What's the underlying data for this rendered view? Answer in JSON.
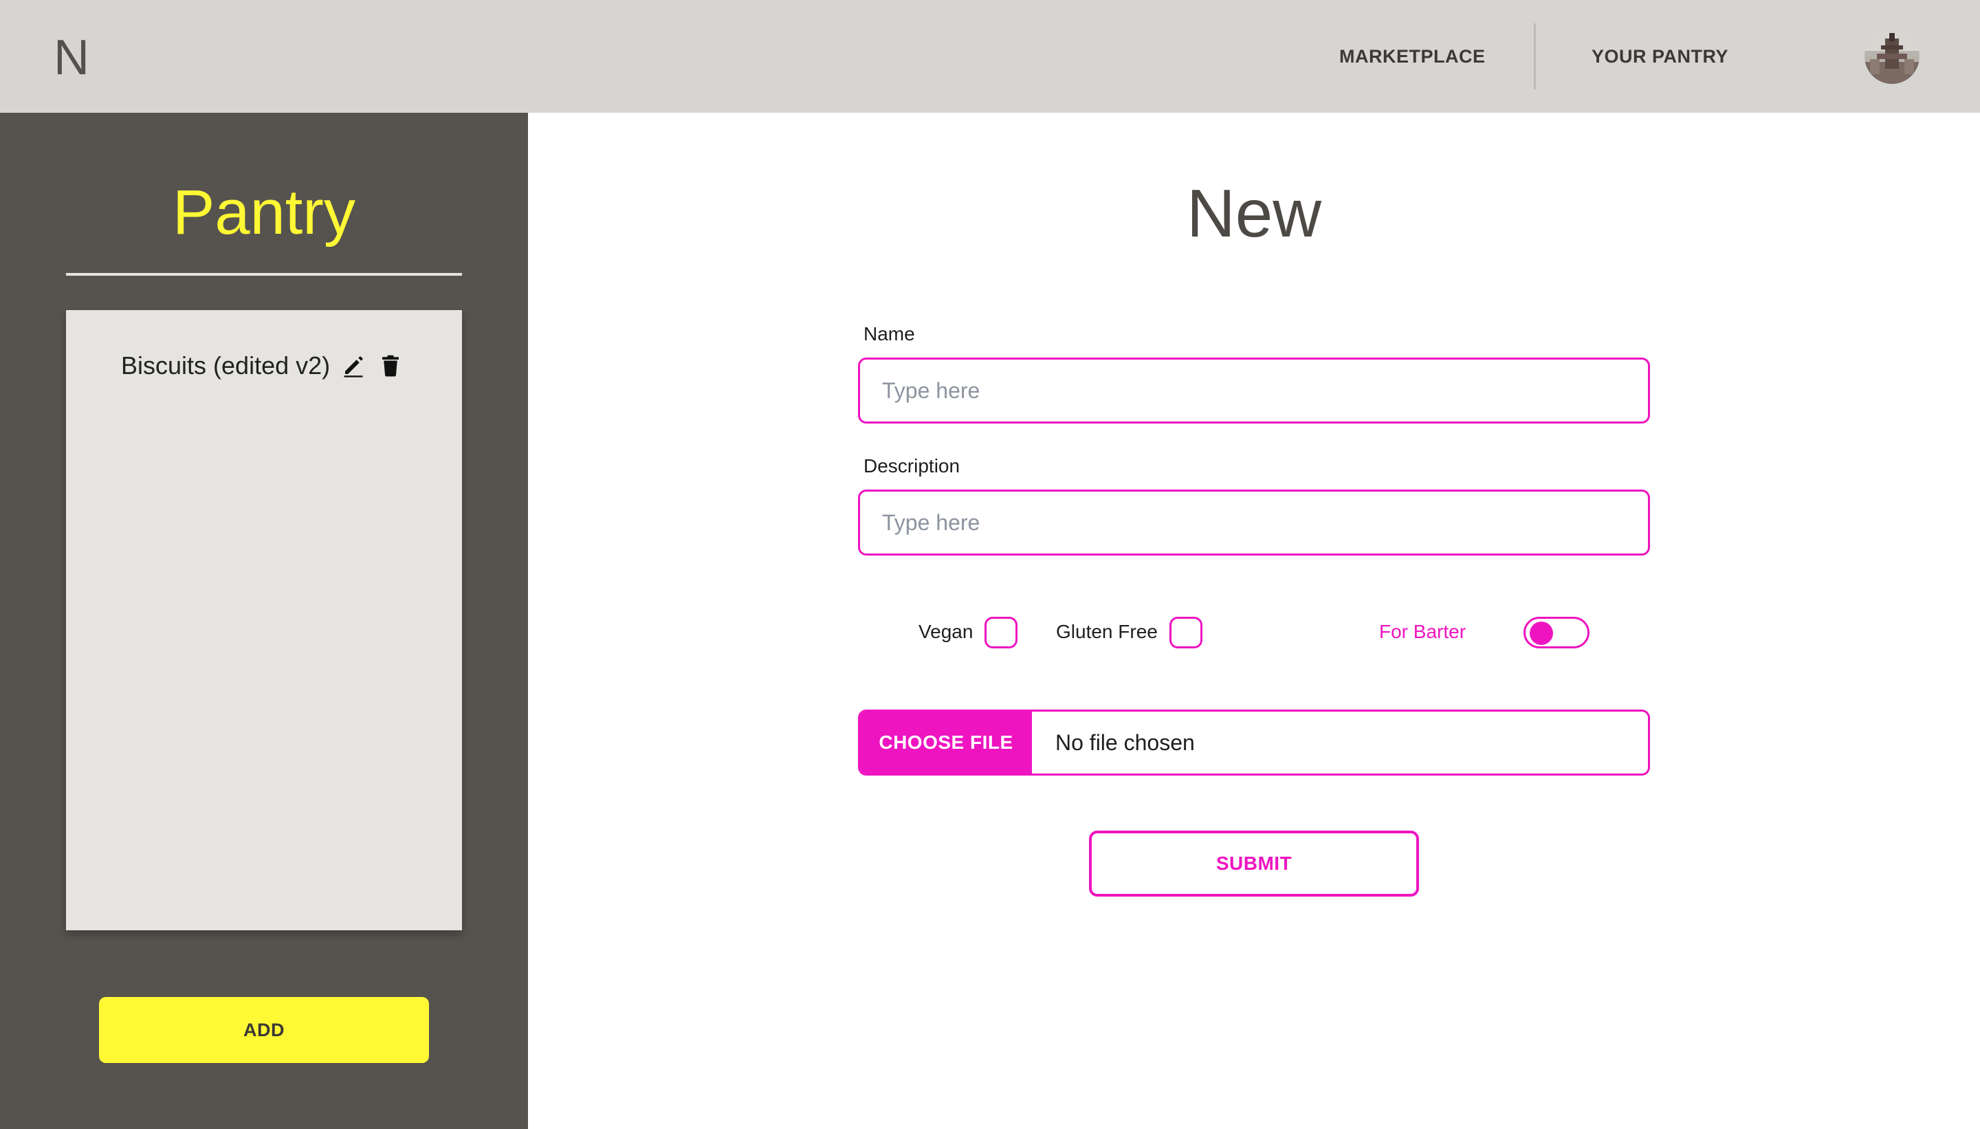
{
  "header": {
    "logo": "N",
    "nav": {
      "marketplace": "MARKETPLACE",
      "your_pantry": "YOUR PANTRY"
    },
    "avatar_icon": "user-avatar"
  },
  "sidebar": {
    "title": "Pantry",
    "items": [
      {
        "label": "Biscuits (edited v2)",
        "edit_icon": "pencil-icon",
        "delete_icon": "trash-icon"
      }
    ],
    "add_label": "ADD"
  },
  "form": {
    "title": "New",
    "name": {
      "label": "Name",
      "placeholder": "Type here",
      "value": ""
    },
    "description": {
      "label": "Description",
      "placeholder": "Type here",
      "value": ""
    },
    "vegan": {
      "label": "Vegan",
      "checked": false
    },
    "gluten_free": {
      "label": "Gluten Free",
      "checked": false
    },
    "for_barter": {
      "label": "For Barter",
      "on": false
    },
    "file": {
      "button_label": "CHOOSE FILE",
      "status": "No file chosen"
    },
    "submit_label": "SUBMIT"
  },
  "colors": {
    "accent": "#ee15c0",
    "sidebar_bg": "#56534e",
    "highlight_yellow": "#fff834",
    "header_bg": "#d6d5d3"
  }
}
